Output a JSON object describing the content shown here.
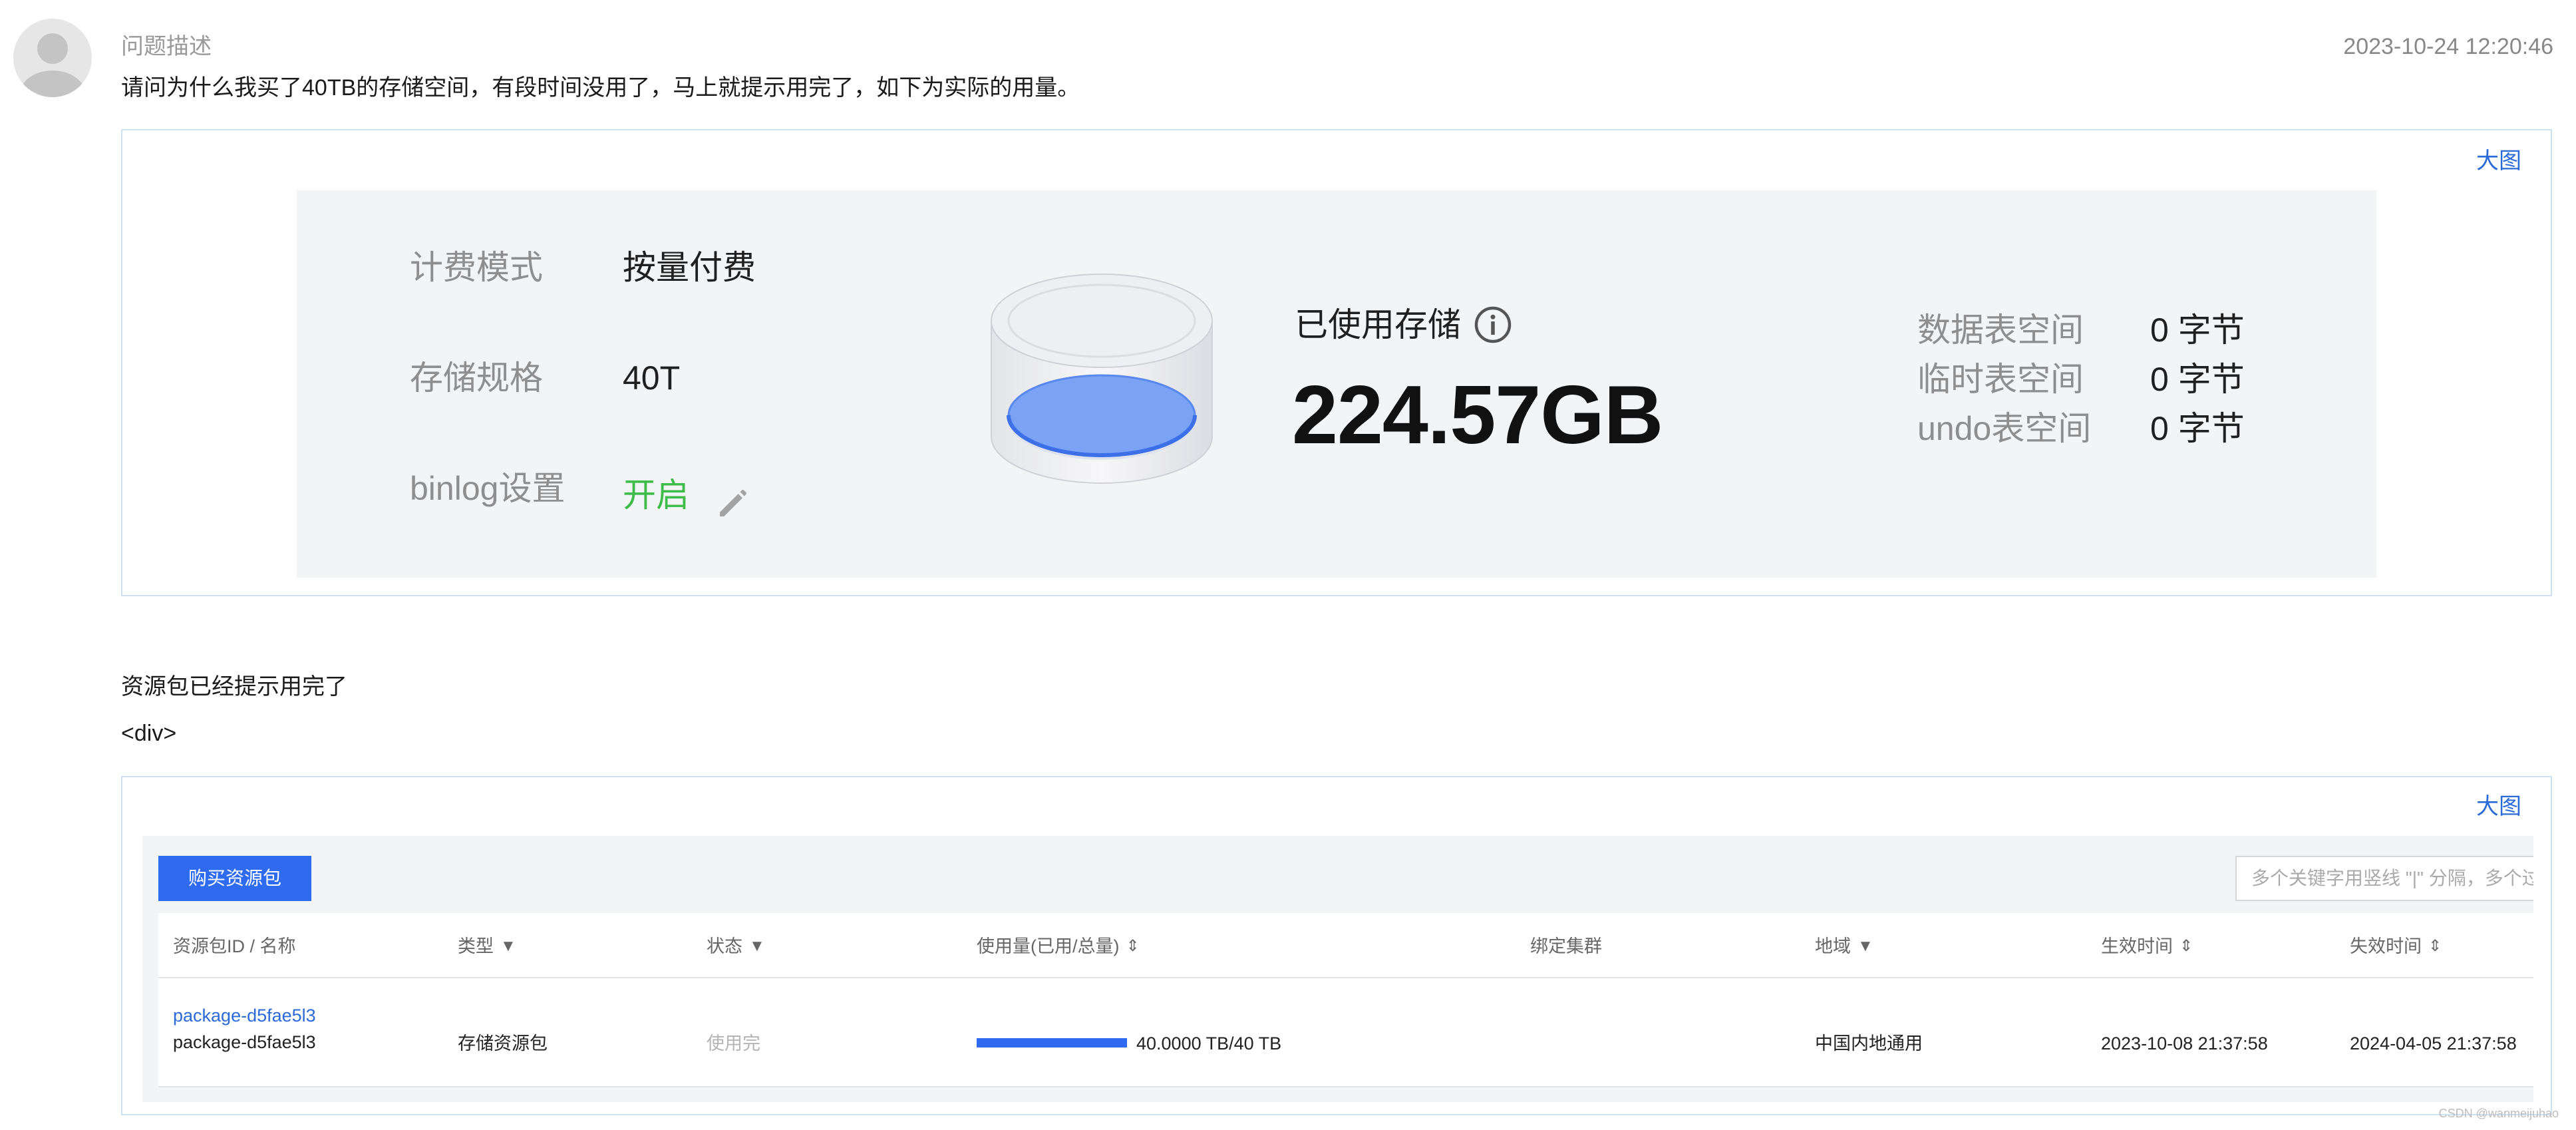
{
  "question": {
    "title": "问题描述",
    "timestamp": "2023-10-24 12:20:46",
    "body": "请问为什么我买了40TB的存储空间，有段时间没用了，马上就提示用完了，如下为实际的用量。"
  },
  "image_viewer": {
    "big_label": "大图"
  },
  "storage": {
    "billing_label": "计费模式",
    "billing_value": "按量付费",
    "spec_label": "存储规格",
    "spec_value": "40T",
    "binlog_label": "binlog设置",
    "binlog_value": "开启",
    "used_label": "已使用存储",
    "used_value": "224.57GB",
    "used_fill_fraction": 0.6,
    "breakdown": [
      {
        "label": "数据表空间",
        "value": "0 字节"
      },
      {
        "label": "临时表空间",
        "value": "0 字节"
      },
      {
        "label": "undo表空间",
        "value": "0 字节"
      }
    ]
  },
  "section2": {
    "text": "资源包已经提示用完了",
    "code_text": "<div>"
  },
  "resource_table": {
    "buy_button": "购买资源包",
    "search_placeholder": "多个关键字用竖线 \"|\" 分隔，多个过",
    "headers": {
      "id_name": "资源包ID / 名称",
      "type": "类型",
      "status": "状态",
      "usage": "使用量(已用/总量)",
      "cluster": "绑定集群",
      "region": "地域",
      "start": "生效时间",
      "end": "失效时间"
    },
    "rows": [
      {
        "id": "package-d5fae5l3",
        "name": "package-d5fae5l3",
        "type": "存储资源包",
        "status": "使用完",
        "usage_text": "40.0000 TB/40 TB",
        "usage_fraction": 1.0,
        "cluster": "",
        "region": "中国内地通用",
        "start": "2023-10-08 21:37:58",
        "end": "2024-04-05 21:37:58"
      }
    ]
  },
  "watermark": "CSDN @wanmeijuhao",
  "colors": {
    "accent": "#2f6bf0",
    "link": "#2a6bd9",
    "green": "#3dbc4a",
    "panel_bg": "#f3f4f6"
  }
}
